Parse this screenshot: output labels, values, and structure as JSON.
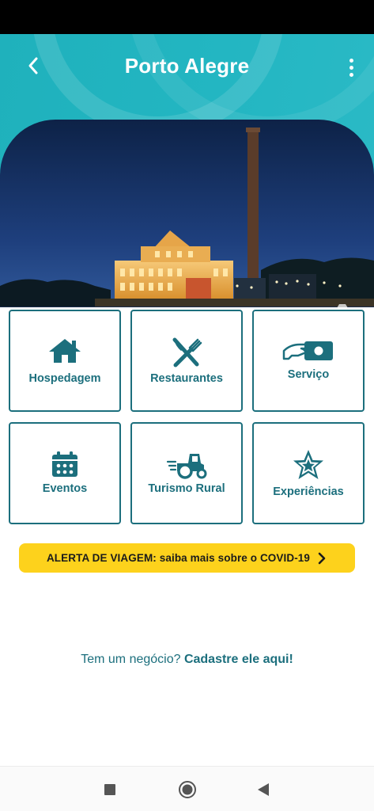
{
  "header": {
    "title": "Porto Alegre",
    "back_icon": "chevron-left-icon",
    "menu_icon": "more-vertical-icon"
  },
  "hero": {
    "camera_icon": "camera-icon"
  },
  "categories": [
    {
      "label": "Hospedagem",
      "icon": "home-icon"
    },
    {
      "label": "Restaurantes",
      "icon": "fork-knife-icon"
    },
    {
      "label": "Serviço",
      "icon": "hand-card-icon"
    },
    {
      "label": "Eventos",
      "icon": "calendar-icon"
    },
    {
      "label": "Turismo Rural",
      "icon": "tractor-icon"
    },
    {
      "label": "Experiências",
      "icon": "star-icon"
    }
  ],
  "alert": {
    "text": "ALERTA DE VIAGEM: saiba mais sobre o COVID-19",
    "icon": "chevron-right-icon"
  },
  "cta": {
    "prefix": "Tem um negócio? ",
    "link": "Cadastre ele aqui!"
  },
  "colors": {
    "header": "#23b6c2",
    "accent": "#1c6f7d",
    "alert": "#fdd21c"
  }
}
